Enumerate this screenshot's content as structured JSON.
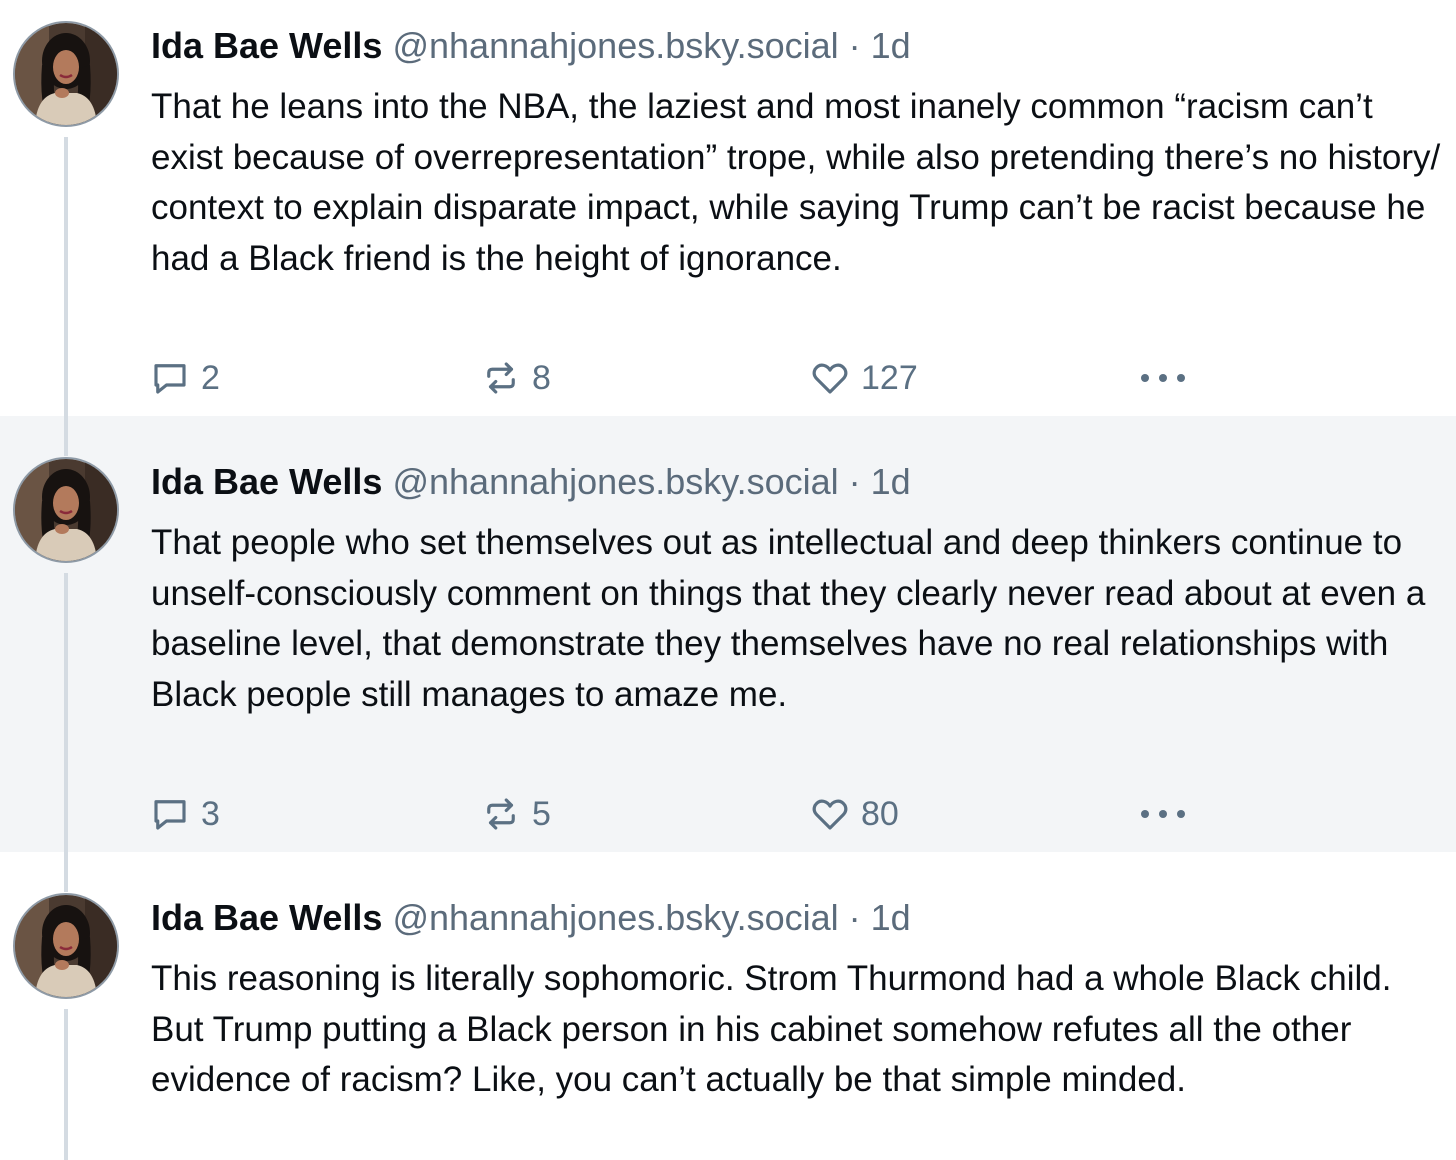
{
  "posts": [
    {
      "author": "Ida Bae Wells",
      "handle": "@nhannahjones.bsky.social",
      "separator": "·",
      "time": "1d",
      "text": "That he leans into the NBA, the laziest and most inanely common “racism can’t exist because of overrepresentation” trope, while also pretending there’s no history/ context to explain disparate impact, while saying Trump can’t be racist because he had a Black friend is the height of ignorance.",
      "replies": "2",
      "reposts": "8",
      "likes": "127"
    },
    {
      "author": "Ida Bae Wells",
      "handle": "@nhannahjones.bsky.social",
      "separator": "·",
      "time": "1d",
      "text": "That people who set themselves out as intellectual and deep thinkers continue to unself-consciously comment on things that they clearly never read about at even a baseline level, that demonstrate they themselves have no real relationships with Black people still manages to amaze me.",
      "replies": "3",
      "reposts": "5",
      "likes": "80"
    },
    {
      "author": "Ida Bae Wells",
      "handle": "@nhannahjones.bsky.social",
      "separator": "·",
      "time": "1d",
      "text": "This reasoning is literally sophomoric. Strom Thurmond had a whole Black child. But Trump putting a Black person in his cabinet somehow refutes all the other evidence of racism? Like, you can’t actually be that simple minded."
    }
  ],
  "icons": {
    "reply": "speech-bubble-icon",
    "repost": "repost-arrows-icon",
    "like": "heart-icon",
    "more": "ellipsis-icon"
  },
  "colors": {
    "highlight_background": "#f3f5f7",
    "thread_line": "#d4dbe2",
    "meta_text": "#5b6b7b",
    "action_icon": "#5b7083"
  }
}
